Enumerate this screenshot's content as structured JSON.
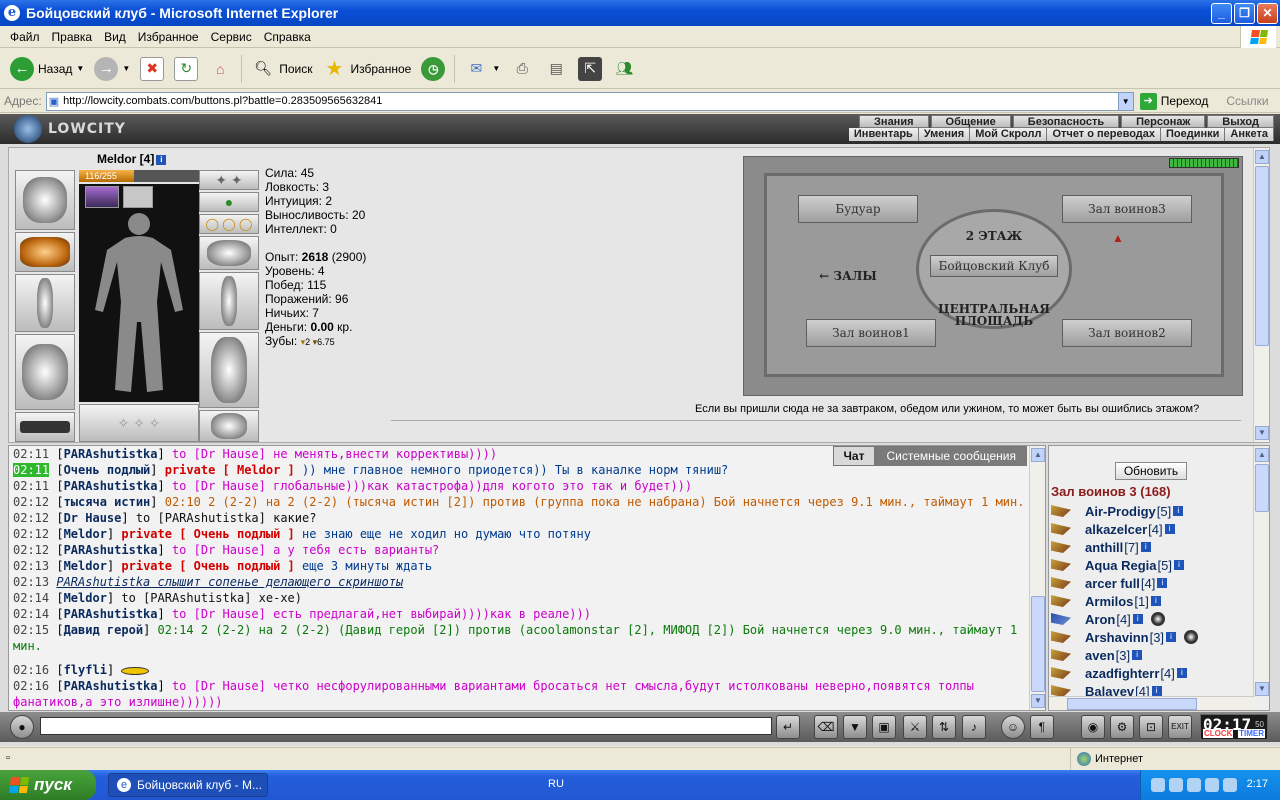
{
  "window": {
    "title": "Бойцовский клуб - Microsoft Internet Explorer"
  },
  "menu": [
    "Файл",
    "Правка",
    "Вид",
    "Избранное",
    "Сервис",
    "Справка"
  ],
  "toolbar": {
    "back_label": "Назад",
    "search_label": "Поиск",
    "favorites_label": "Избранное"
  },
  "address": {
    "label": "Адрес:",
    "url": "http://lowcity.combats.com/buttons.pl?battle=0.283509565632841",
    "go_label": "Переход",
    "links_label": "Ссылки"
  },
  "site": {
    "logo": "LOWCITY",
    "top_nav": [
      "Знания",
      "Общение",
      "Безопасность",
      "Персонаж",
      "Выход"
    ],
    "sub_nav": [
      "Инвентарь",
      "Умения",
      "Мой Скролл",
      "Отчет о переводах",
      "Поединки",
      "Анкета"
    ]
  },
  "character": {
    "name": "Meldor [4]",
    "hp": "116/255",
    "hp_fraction": 0.455,
    "stats": [
      "Сила: 45",
      "Ловкость: 3",
      "Интуиция: 2",
      "Выносливость: 20",
      "Интеллект: 0"
    ],
    "exp_label": "Опыт:",
    "exp_value": "2618",
    "exp_next": "(2900)",
    "level": "Уровень: 4",
    "wins": "Побед: 115",
    "losses": "Поражений: 96",
    "draws": "Ничьих: 7",
    "money_label": "Деньги:",
    "money_value": "0.00",
    "money_unit": "кр.",
    "teeth_label": "Зубы:",
    "teeth_a": "2",
    "teeth_b": "6.75"
  },
  "map": {
    "rooms": [
      "Будуар",
      "Зал воинов3",
      "Зал воинов1",
      "Зал воинов2"
    ],
    "floor": "2 ЭТАЖ",
    "club": "Бойцовский Клуб",
    "halls": "← ЗАЛЫ",
    "square": "ЦЕНТРАЛЬНАЯ ПЛОЩАДЬ",
    "caption": "Если вы пришли сюда не за завтраком, обедом или ужином, то может быть вы ошиблись этажом?"
  },
  "chat": {
    "tabs": [
      "Чат",
      "Системные сообщения"
    ],
    "lines": [
      {
        "time": "02:11",
        "nick": "PARAshutistka",
        "pre": "",
        "text": "to [Dr Hause] не менять,внести коррективы))))",
        "cls": "msg-pink"
      },
      {
        "time": "02:11",
        "nick": "Очень подлый",
        "pre": "private [ Meldor ]",
        "text": ")) мне главное немного приодется)) Ты в каналке норм тяниш?",
        "cls": "msg-blue",
        "hl": true
      },
      {
        "time": "02:11",
        "nick": "PARAshutistka",
        "pre": "",
        "text": "to [Dr Hause] глобальные)))как катастрофа))для когото это так и будет)))",
        "cls": "msg-pink"
      },
      {
        "time": "02:12",
        "nick": "тысяча истин",
        "pre": "",
        "text": "02:10 2 (2-2) на 2 (2-2) (тысяча истин [2]) против (группа пока не набрана) Бой начнется через 9.1 мин., таймаут 1 мин.",
        "cls": "msg-orange"
      },
      {
        "time": "02:12",
        "nick": "Dr Hause",
        "pre": "",
        "text": "to [PARAshutistka] какие?",
        "cls": "msg-plain"
      },
      {
        "time": "02:12",
        "nick": "Meldor",
        "pre": "private [ Очень подлый ]",
        "text": "не знаю еще не ходил но думаю что потяну",
        "cls": "msg-blue"
      },
      {
        "time": "02:12",
        "nick": "PARAshutistka",
        "pre": "",
        "text": "to [Dr Hause] а у тебя есть варианты?",
        "cls": "msg-pink"
      },
      {
        "time": "02:13",
        "nick": "Meldor",
        "pre": "private [ Очень подлый ]",
        "text": "еще 3 минуты ждать",
        "cls": "msg-blue"
      },
      {
        "time": "02:13",
        "nick": "",
        "pre": "",
        "text": "PARAshutistka слышит сопенье делающего скриншоты",
        "cls": "ital"
      },
      {
        "time": "02:14",
        "nick": "Meldor",
        "pre": "",
        "text": "to [PARAshutistka] хе-хе)",
        "cls": "msg-plain"
      },
      {
        "time": "02:14",
        "nick": "PARAshutistka",
        "pre": "",
        "text": "to [Dr Hause] есть предлагай,нет выбирай))))как в реале)))",
        "cls": "msg-pink"
      },
      {
        "time": "02:15",
        "nick": "Давид герой",
        "pre": "",
        "text": "02:14 2 (2-2) на 2 (2-2) (Давид герой [2]) против (acoolamonstar [2], МИФОД [2]) Бой начнется через 9.0 мин., таймаут 1 мин.",
        "cls": "msg-green"
      },
      {
        "time": "02:16",
        "nick": "flyfli",
        "pre": "",
        "text": "",
        "cls": "msg-plain"
      },
      {
        "time": "02:16",
        "nick": "PARAshutistka",
        "pre": "",
        "text": "to [Dr Hause] четко несфорулированными вариантами бросаться нет смысла,будут истолкованы неверно,появятся толпы фанатиков,а это излишне))))))",
        "cls": "msg-pink"
      }
    ]
  },
  "players": {
    "refresh_label": "Обновить",
    "room": "Зал воинов 3 (168)",
    "list": [
      {
        "name": "Air-Prodigy",
        "level": "[5]"
      },
      {
        "name": "alkazelcer",
        "level": "[4]"
      },
      {
        "name": "anthill",
        "level": "[7]"
      },
      {
        "name": "Aqua Regia",
        "level": "[5]"
      },
      {
        "name": "arcer full",
        "level": "[4]"
      },
      {
        "name": "Armilos",
        "level": "[1]"
      },
      {
        "name": "Aron",
        "level": "[4]"
      },
      {
        "name": "Arshavinn",
        "level": "[3]"
      },
      {
        "name": "aven",
        "level": "[3]"
      },
      {
        "name": "azadfighterr",
        "level": "[4]"
      },
      {
        "name": "Balayev",
        "level": "[4]"
      }
    ]
  },
  "clock": {
    "time": "02:17",
    "sec": "50",
    "label1": "CLOCK",
    "label2": "TIMER"
  },
  "status": {
    "zone": "Интернет"
  },
  "taskbar": {
    "start": "пуск",
    "item": "Бойцовский клуб - M...",
    "lang": "RU",
    "time": "2:17"
  }
}
